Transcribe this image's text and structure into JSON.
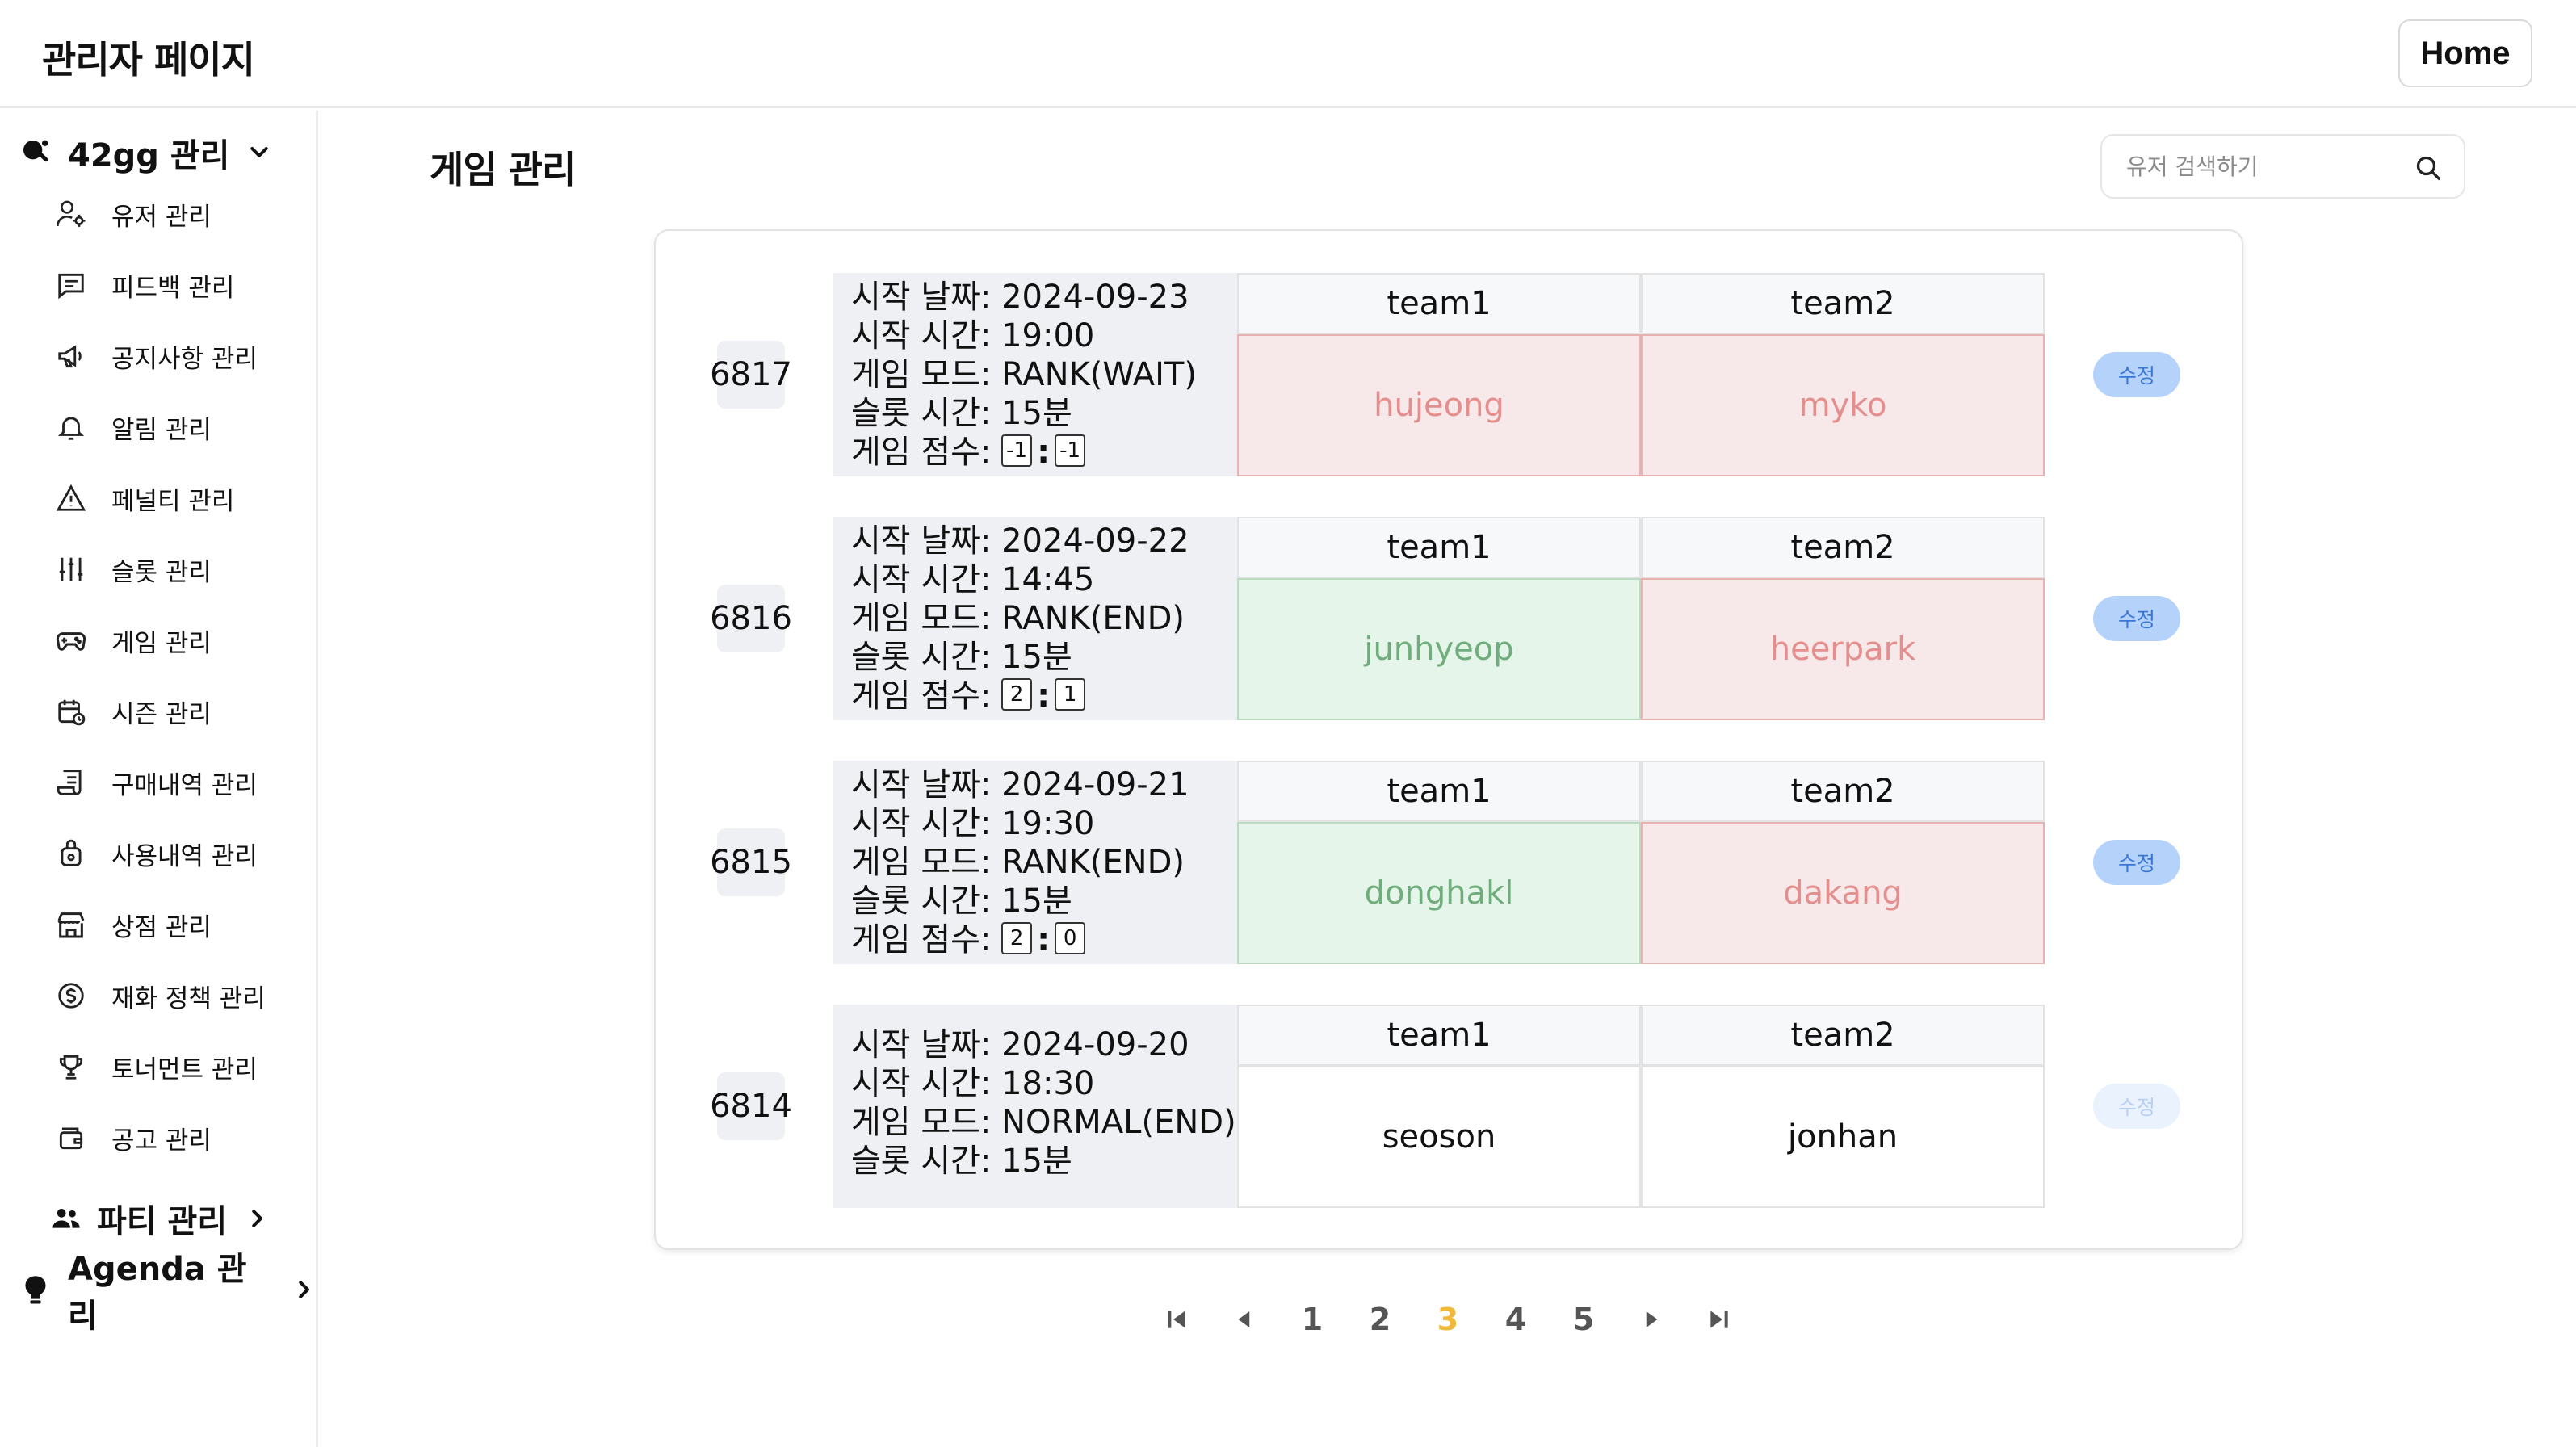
{
  "header": {
    "title": "관리자 페이지",
    "home_label": "Home"
  },
  "sidebar": {
    "group_42gg": {
      "label": "42gg 관리",
      "expanded": true
    },
    "items": [
      {
        "label": "유저 관리",
        "icon": "user-gear-icon"
      },
      {
        "label": "피드백 관리",
        "icon": "message-icon"
      },
      {
        "label": "공지사항 관리",
        "icon": "megaphone-icon"
      },
      {
        "label": "알림 관리",
        "icon": "bell-icon"
      },
      {
        "label": "페널티 관리",
        "icon": "warning-icon"
      },
      {
        "label": "슬롯 관리",
        "icon": "sliders-icon"
      },
      {
        "label": "게임 관리",
        "icon": "gamepad-icon"
      },
      {
        "label": "시즌 관리",
        "icon": "calendar-clock-icon"
      },
      {
        "label": "구매내역 관리",
        "icon": "receipt-icon"
      },
      {
        "label": "사용내역 관리",
        "icon": "bag-icon"
      },
      {
        "label": "상점 관리",
        "icon": "store-icon"
      },
      {
        "label": "재화 정책 관리",
        "icon": "coin-icon"
      },
      {
        "label": "토너먼트 관리",
        "icon": "trophy-icon"
      },
      {
        "label": "공고 관리",
        "icon": "wallet-icon"
      }
    ],
    "group_party": {
      "label": "파티 관리",
      "expanded": false
    },
    "group_agenda": {
      "label": "Agenda 관리",
      "expanded": false
    }
  },
  "main": {
    "title": "게임 관리",
    "search": {
      "placeholder": "유저 검색하기",
      "value": ""
    },
    "games": [
      {
        "id": "6817",
        "date_line": "시작 날짜: 2024-09-23",
        "time_line": "시작 시간: 19:00",
        "mode_line": "게임 모드: RANK(WAIT)",
        "slot_line": "슬롯 시간: 15분",
        "score_label": "게임 점수:",
        "score1": "-1",
        "score2": "-1",
        "team1_header": "team1",
        "team2_header": "team2",
        "team1_player": "hujeong",
        "team2_player": "myko",
        "team1_status": "red",
        "team2_status": "red",
        "edit_label": "수정",
        "edit_enabled": true
      },
      {
        "id": "6816",
        "date_line": "시작 날짜: 2024-09-22",
        "time_line": "시작 시간: 14:45",
        "mode_line": "게임 모드: RANK(END)",
        "slot_line": "슬롯 시간: 15분",
        "score_label": "게임 점수:",
        "score1": "2",
        "score2": "1",
        "team1_header": "team1",
        "team2_header": "team2",
        "team1_player": "junhyeop",
        "team2_player": "heerpark",
        "team1_status": "green",
        "team2_status": "red",
        "edit_label": "수정",
        "edit_enabled": true
      },
      {
        "id": "6815",
        "date_line": "시작 날짜: 2024-09-21",
        "time_line": "시작 시간: 19:30",
        "mode_line": "게임 모드: RANK(END)",
        "slot_line": "슬롯 시간: 15분",
        "score_label": "게임 점수:",
        "score1": "2",
        "score2": "0",
        "team1_header": "team1",
        "team2_header": "team2",
        "team1_player": "donghakl",
        "team2_player": "dakang",
        "team1_status": "green",
        "team2_status": "red",
        "edit_label": "수정",
        "edit_enabled": true
      },
      {
        "id": "6814",
        "date_line": "시작 날짜: 2024-09-20",
        "time_line": "시작 시간: 18:30",
        "mode_line": "게임 모드: NORMAL(END)",
        "slot_line": "슬롯 시간: 15분",
        "team1_header": "team1",
        "team2_header": "team2",
        "team1_player": "seoson",
        "team2_player": "jonhan",
        "team1_status": "plain",
        "team2_status": "plain",
        "edit_label": "수정",
        "edit_enabled": false
      }
    ]
  },
  "pagination": {
    "pages": [
      "1",
      "2",
      "3",
      "4",
      "5"
    ],
    "current": "3",
    "active_color": "#f0b93a"
  },
  "colors": {
    "win_bg": "#e6f5ea",
    "lose_bg": "#f7e9e9",
    "edit_button": "#b5d2fb"
  }
}
